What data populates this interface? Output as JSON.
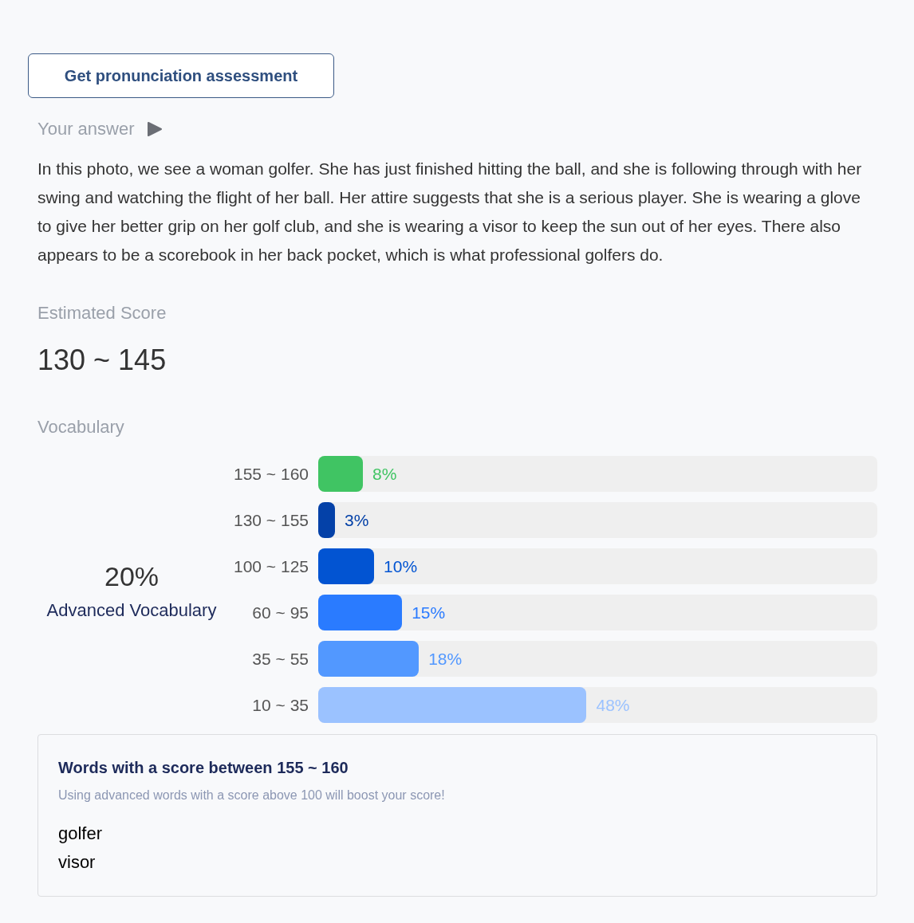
{
  "assessment_button": "Get pronunciation assessment",
  "answer": {
    "heading": "Your answer",
    "text": "In this photo, we see a woman golfer. She has just finished hitting the ball, and she is following through with her swing and watching the flight of her ball. Her attire suggests that she is a serious player. She is wearing a glove to give her better grip on her golf club, and she is wearing a visor to keep the sun out of her eyes. There also appears to be a scorebook in her back pocket, which is what professional golfers do."
  },
  "estimated_score": {
    "heading": "Estimated Score",
    "value": "130 ~ 145"
  },
  "vocabulary": {
    "heading": "Vocabulary",
    "percent": "20%",
    "caption": "Advanced Vocabulary",
    "bands": [
      {
        "range": "155 ~ 160",
        "level": 0.08,
        "reading": "8%",
        "color": "#40c463"
      },
      {
        "range": "130 ~ 155",
        "level": 0.03,
        "reading": "3%",
        "color": "#0441a8"
      },
      {
        "range": "100 ~ 125",
        "level": 0.1,
        "reading": "10%",
        "color": "#0254d2"
      },
      {
        "range": "60 ~ 95",
        "level": 0.15,
        "reading": "15%",
        "color": "#2a7bff"
      },
      {
        "range": "35 ~ 55",
        "level": 0.18,
        "reading": "18%",
        "color": "#5298ff"
      },
      {
        "range": "10 ~ 35",
        "level": 0.48,
        "reading": "48%",
        "color": "#9bc2ff"
      }
    ]
  },
  "words_panel": {
    "title": "Words with a score between 155 ~ 160",
    "hint": "Using advanced words with a score above 100 will boost your score!",
    "words": [
      "golfer",
      "visor"
    ]
  }
}
